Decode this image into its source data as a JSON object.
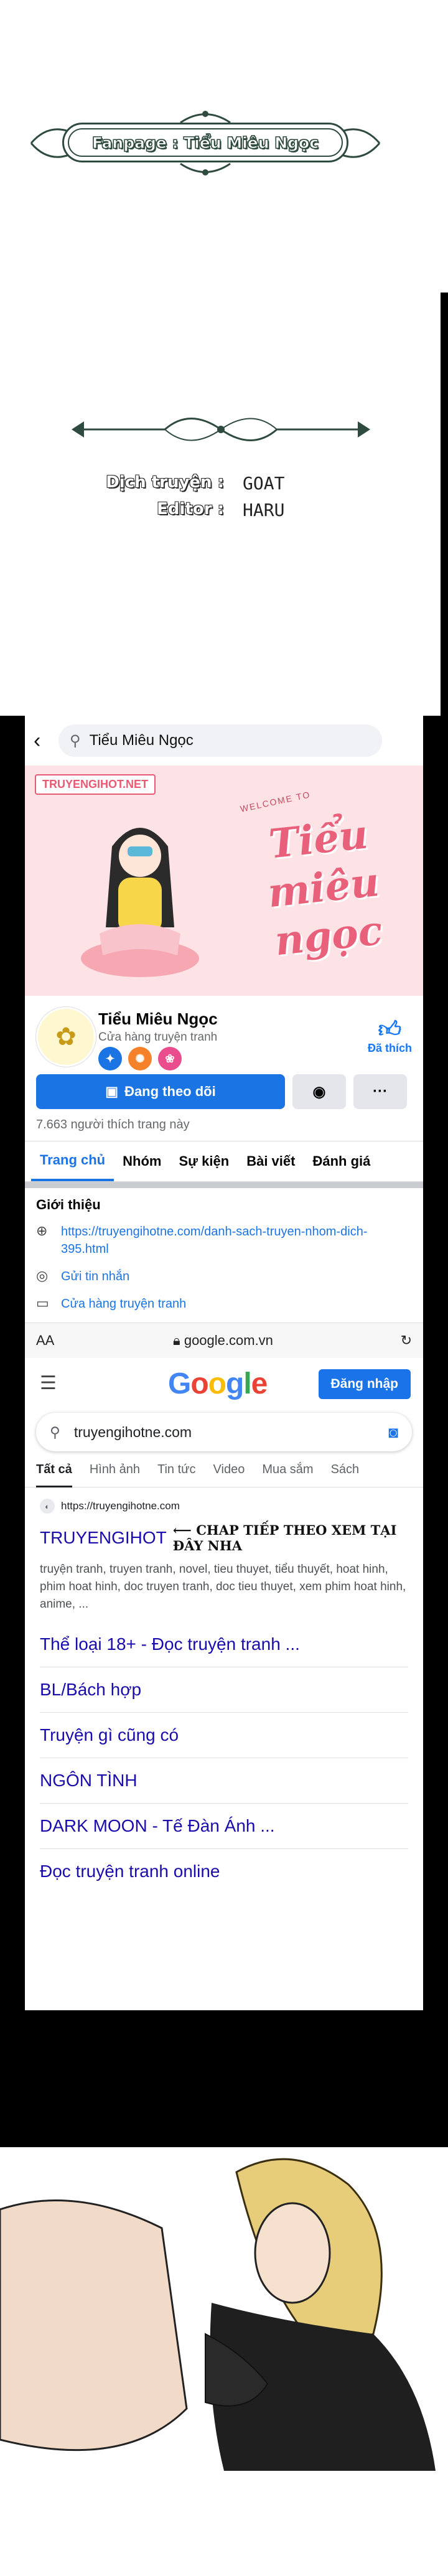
{
  "fanpage": {
    "label": "Fanpage : Tiểu Miêu Ngọc"
  },
  "credits": [
    {
      "key": "Dịch truyện :",
      "value": "GOAT"
    },
    {
      "key": "Editor :",
      "value": "HARU"
    }
  ],
  "facebook": {
    "search_text": "Tiểu Miêu Ngọc",
    "cover_logo": "TRUYENGIHOT.NET",
    "cover_welcome": "WELCOME TO",
    "cover_title": "Tiểu miêu ngọc",
    "page_name": "Tiểu Miêu Ngọc",
    "page_category": "Cửa hàng truyện tranh",
    "liked_label": "Đã thích",
    "follow_label": "Đang theo dõi",
    "more_label": "···",
    "likes_count": "7.663 người thích trang này",
    "tabs": [
      "Trang chủ",
      "Nhóm",
      "Sự kiện",
      "Bài viết",
      "Đánh giá"
    ],
    "intro_title": "Giới thiệu",
    "intro_link": "https://truyengihotne.com/danh-sach-truyen-nhom-dich-395.html",
    "intro_message": "Gửi tin nhắn",
    "intro_category": "Cửa hàng truyện tranh"
  },
  "browser": {
    "aa": "AA",
    "url": "google.com.vn"
  },
  "google": {
    "signin": "Đăng nhập",
    "query": "truyengihotne.com",
    "tabs": [
      "Tất cả",
      "Hình ảnh",
      "Tin tức",
      "Video",
      "Mua sắm",
      "Sách"
    ],
    "result_source": "https://truyengihotne.com",
    "result_title": "TRUYENGIHOT",
    "result_annotation": "⟵ CHAP TIẾP THEO XEM TẠI ĐÂY NHA",
    "result_desc": "truyện tranh, truyen tranh, novel, tieu thuyet, tiểu thuyết, hoat hinh, phim hoat hinh, doc truyen tranh, doc tieu thuyet, xem phim hoat hinh, anime, ...",
    "sitelinks": [
      "Thể loại 18+ - Đọc truyện tranh ...",
      "BL/Bách hợp",
      "Truyện gì cũng có",
      "NGÔN TÌNH",
      "DARK MOON - Tế Đàn Ánh ...",
      "Đọc truyện tranh online"
    ]
  }
}
